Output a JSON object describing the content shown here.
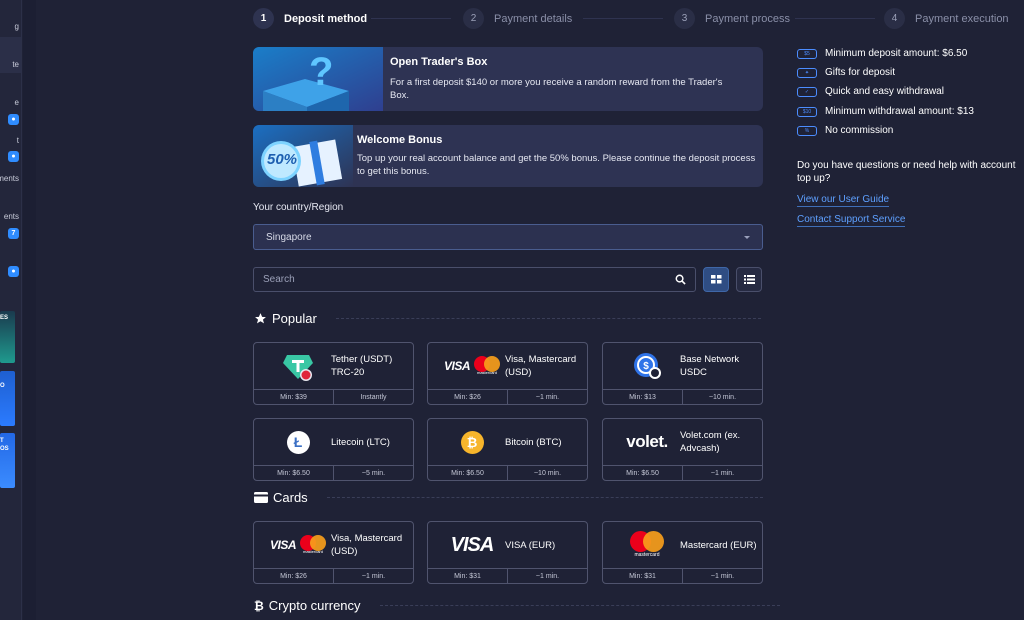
{
  "sidebar": {
    "items": [
      {
        "text": "g"
      },
      {
        "text": "te"
      },
      {
        "text": "e"
      },
      {
        "text": "t"
      },
      {
        "text": "ments"
      },
      {
        "text": "ents"
      }
    ],
    "badges": [
      "7"
    ],
    "promos": [
      "ES",
      "O",
      "T",
      "OS"
    ]
  },
  "steps": [
    {
      "num": "1",
      "label": "Deposit method"
    },
    {
      "num": "2",
      "label": "Payment details"
    },
    {
      "num": "3",
      "label": "Payment process"
    },
    {
      "num": "4",
      "label": "Payment execution"
    }
  ],
  "banners": [
    {
      "title": "Open Trader's Box",
      "text": "For a first deposit $140 or more you receive a random reward from the Trader's Box."
    },
    {
      "title": "Welcome Bonus",
      "text": "Top up your real account balance and get the 50% bonus. Please continue the deposit process to get this bonus.",
      "art_text": "50%"
    }
  ],
  "country": {
    "label": "Your country/Region",
    "value": "Singapore"
  },
  "search": {
    "placeholder": "Search"
  },
  "sections": {
    "popular": "Popular",
    "cards": "Cards",
    "crypto": "Crypto currency"
  },
  "popular": [
    {
      "name": "Tether (USDT) TRC-20",
      "min": "Min: $39",
      "time": "Instantly",
      "logo": "tether-icon"
    },
    {
      "name": "Visa, Mastercard (USD)",
      "min": "Min: $26",
      "time": "~1 min.",
      "logo": "visa-mastercard-logo",
      "logo_text": "VISA",
      "mc_text": "mastercard"
    },
    {
      "name": "Base Network USDC",
      "min": "Min: $13",
      "time": "~10 min.",
      "logo": "usdc-icon"
    },
    {
      "name": "Litecoin (LTC)",
      "min": "Min: $6.50",
      "time": "~5 min.",
      "logo": "litecoin-icon",
      "logo_text": "Ł"
    },
    {
      "name": "Bitcoin (BTC)",
      "min": "Min: $6.50",
      "time": "~10 min.",
      "logo": "bitcoin-icon",
      "logo_text": "₿"
    },
    {
      "name": "Volet.com (ex. Advcash)",
      "min": "Min: $6.50",
      "time": "~1 min.",
      "logo": "volet-logo",
      "logo_text": "volet."
    }
  ],
  "cards": [
    {
      "name": "Visa, Mastercard (USD)",
      "min": "Min: $26",
      "time": "~1 min.",
      "logo": "visa-mastercard-logo",
      "logo_text": "VISA",
      "mc_text": "mastercard"
    },
    {
      "name": "VISA (EUR)",
      "min": "Min: $31",
      "time": "~1 min.",
      "logo": "visa-logo",
      "logo_text": "VISA"
    },
    {
      "name": "Mastercard (EUR)",
      "min": "Min: $31",
      "time": "~1 min.",
      "logo": "mastercard-logo",
      "mc_text": "mastercard"
    }
  ],
  "info": [
    {
      "icon": "min-deposit-icon",
      "icon_text": "$5",
      "text": "Minimum deposit amount: $6.50"
    },
    {
      "icon": "gift-icon",
      "icon_text": "",
      "text": "Gifts for deposit"
    },
    {
      "icon": "check-icon",
      "icon_text": "",
      "text": "Quick and easy withdrawal"
    },
    {
      "icon": "min-withdrawal-icon",
      "icon_text": "$10",
      "text": "Minimum withdrawal amount: $13"
    },
    {
      "icon": "percent-icon",
      "icon_text": "%",
      "text": "No commission"
    }
  ],
  "help": {
    "text": "Do you have questions or need help with account top up?",
    "guide": "View our User Guide",
    "support": "Contact Support Service"
  },
  "colors": {
    "background": "#1f2236",
    "banner": "#2e3353",
    "accent": "#4c8dff",
    "link": "#5ea0ff"
  }
}
